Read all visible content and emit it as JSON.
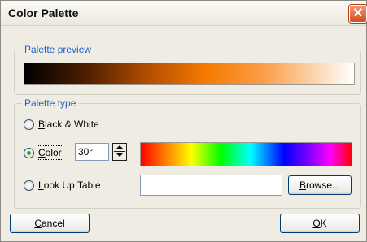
{
  "window": {
    "title": "Color Palette",
    "close_glyph": "✕"
  },
  "preview": {
    "legend": "Palette preview"
  },
  "palette_type": {
    "legend": "Palette type",
    "options": [
      {
        "label": "Black & White",
        "checked": false,
        "underline_char": "B",
        "rest": "lack & White"
      },
      {
        "label": "Color",
        "checked": true,
        "underline_char": "C",
        "rest": "olor"
      },
      {
        "label": "Look Up Table",
        "checked": false,
        "underline_char": "L",
        "rest": "ook Up Table"
      }
    ],
    "angle_value": "30°",
    "lut_value": "",
    "browse_label": {
      "underline_char": "B",
      "rest": "rowse..."
    }
  },
  "buttons": {
    "cancel": {
      "underline_char": "C",
      "rest": "ancel"
    },
    "ok": {
      "underline_char": "O",
      "rest": "K"
    }
  },
  "colors": {
    "legend_text": "#1d5fd0",
    "radio_check": "#2aa62a",
    "close_red": "#d44b22"
  }
}
